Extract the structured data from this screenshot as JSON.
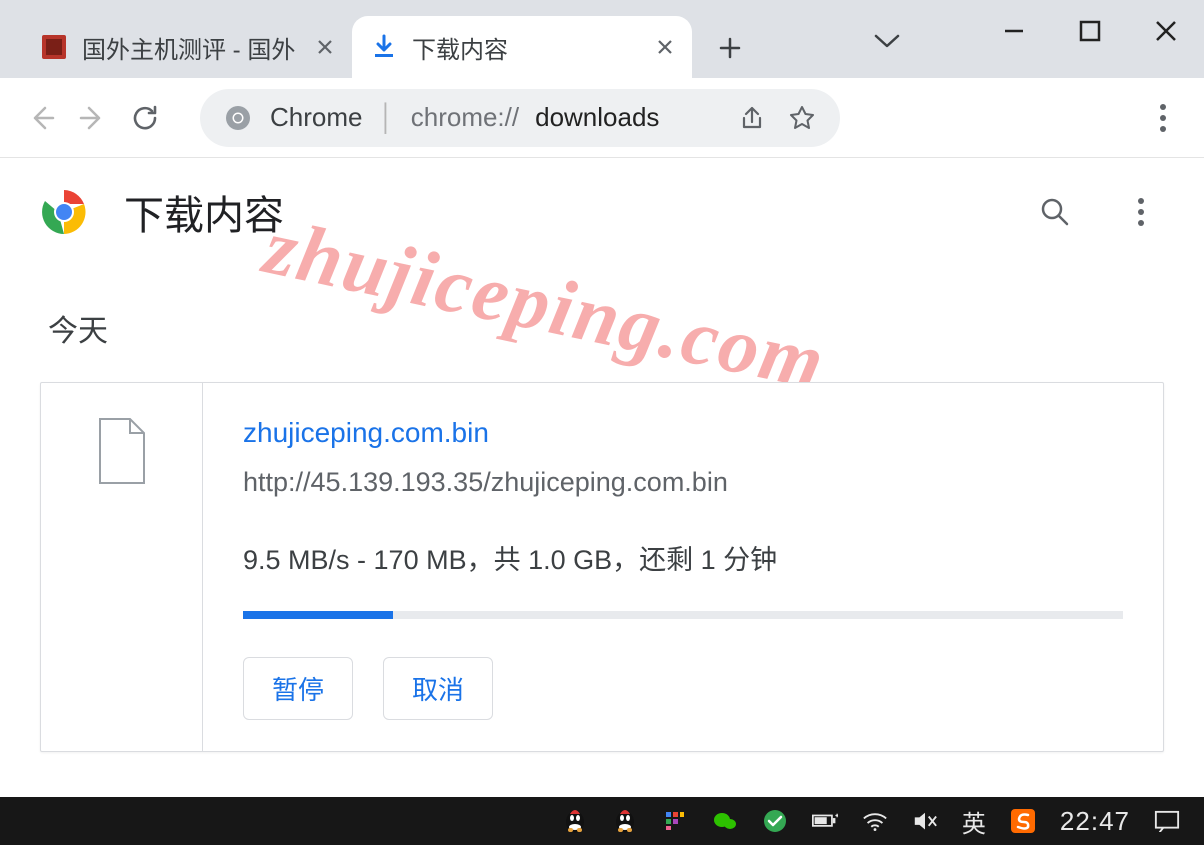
{
  "window": {
    "tab_chevron": "v"
  },
  "tabs": [
    {
      "title": "国外主机测评 - 国外",
      "active": false
    },
    {
      "title": "下载内容",
      "active": true
    }
  ],
  "newtab": "+",
  "omnibox": {
    "chip": "Chrome",
    "scheme": "chrome://",
    "host": "downloads"
  },
  "page": {
    "title": "下载内容",
    "date_section": "今天"
  },
  "download": {
    "filename": "zhujiceping.com.bin",
    "url": "http://45.139.193.35/zhujiceping.com.bin",
    "speed": "9.5 MB/s",
    "downloaded": "170 MB",
    "total": "1.0 GB",
    "eta": "1 分钟",
    "status_line": "9.5 MB/s - 170 MB，共 1.0 GB，还剩 1 分钟",
    "progress_percent": 17,
    "actions": {
      "pause": "暂停",
      "cancel": "取消"
    }
  },
  "watermark": "zhujiceping.com",
  "taskbar": {
    "ime": "英",
    "time": "22:47"
  }
}
